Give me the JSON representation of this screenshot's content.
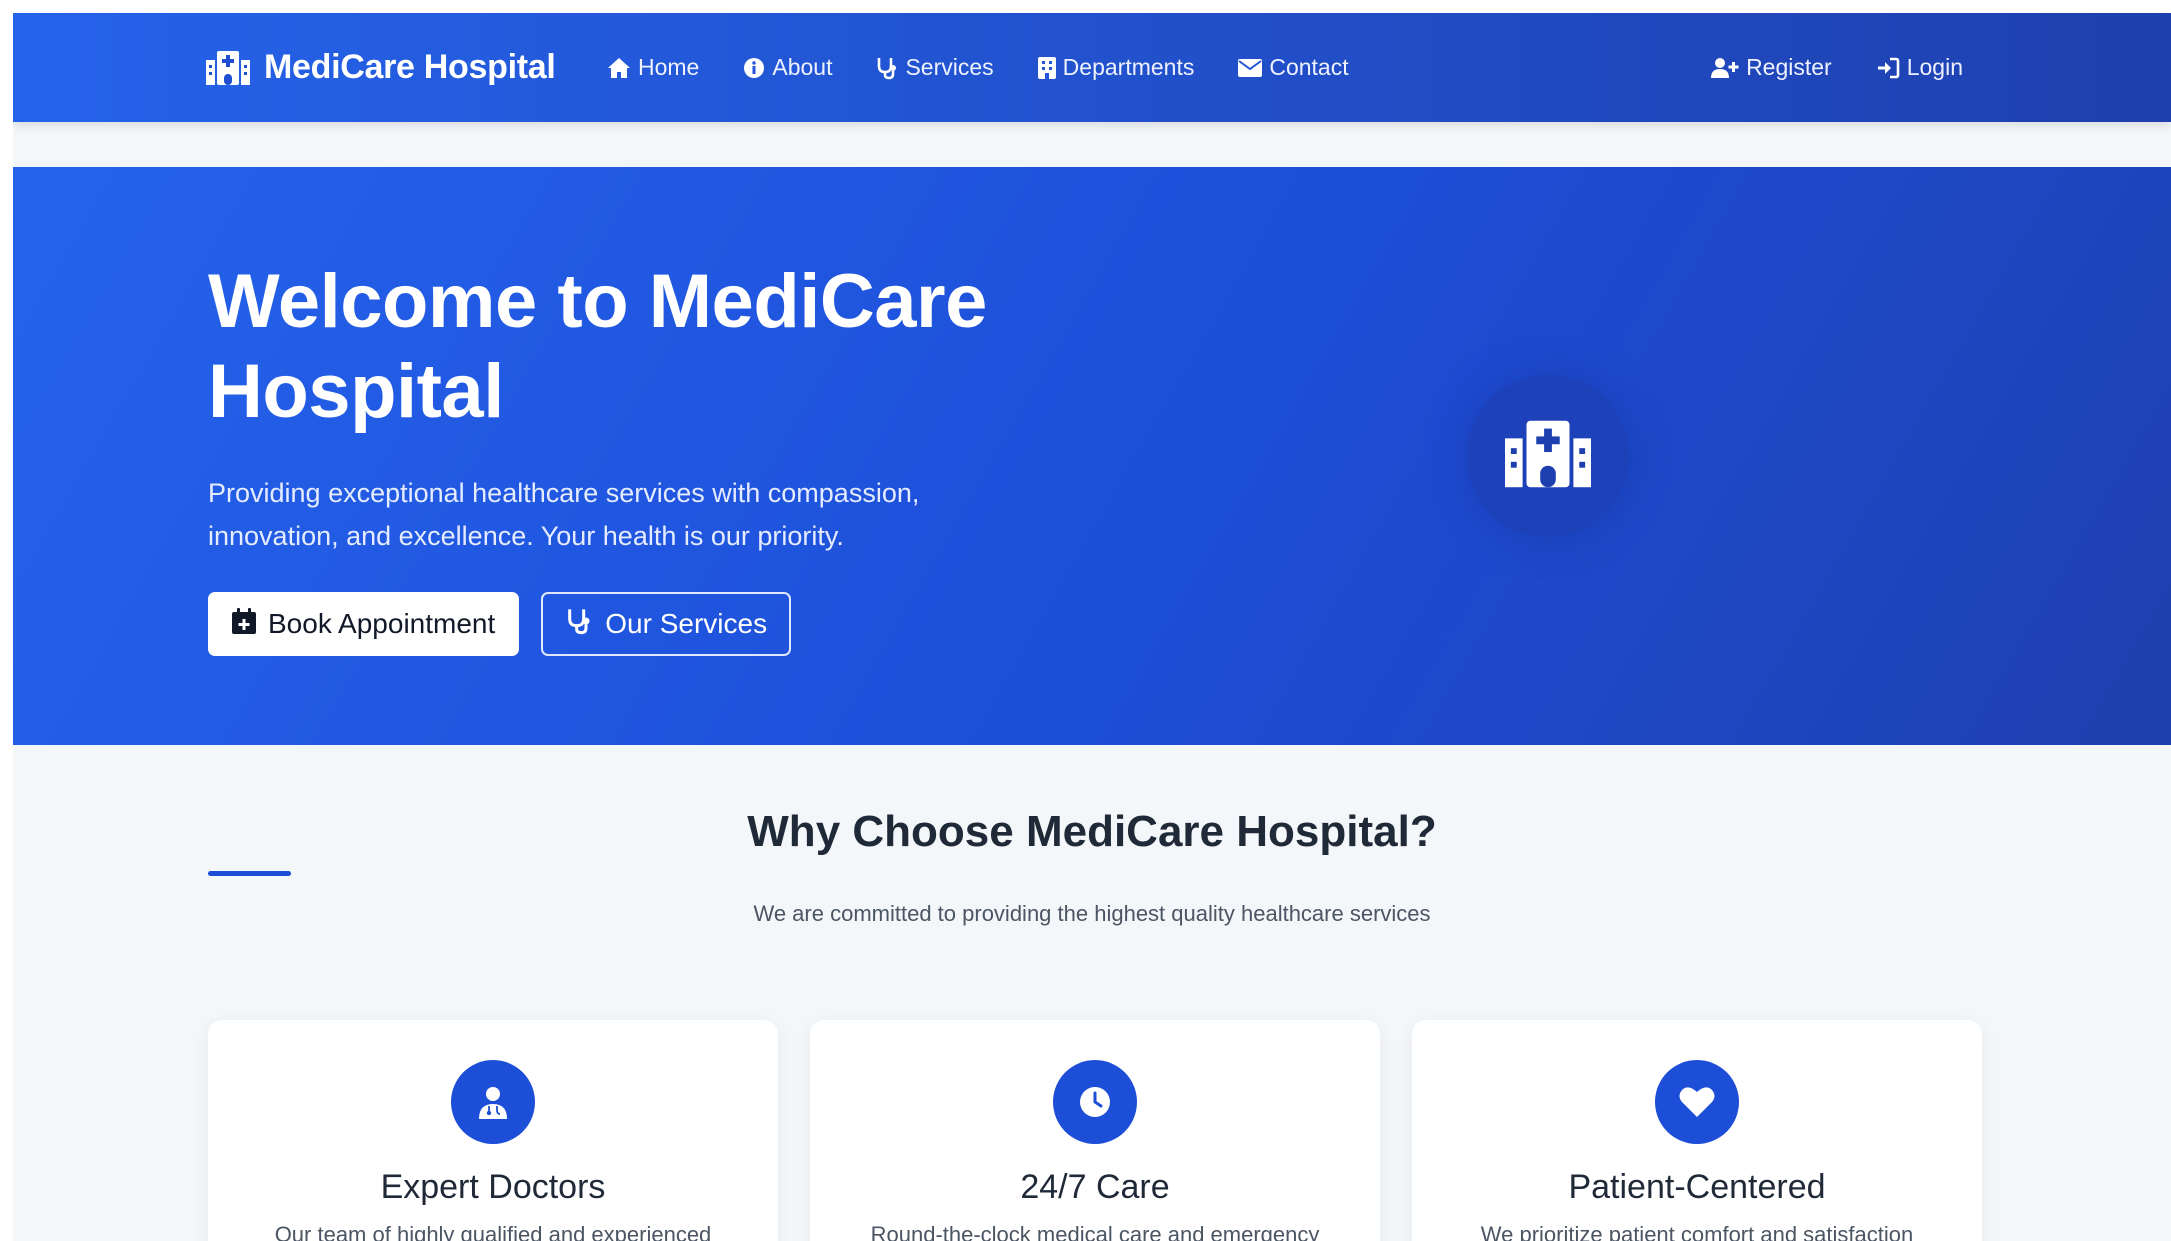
{
  "navbar": {
    "brand": "MediCare Hospital",
    "links": [
      {
        "label": "Home",
        "icon": "home-icon"
      },
      {
        "label": "About",
        "icon": "info-icon"
      },
      {
        "label": "Services",
        "icon": "stethoscope-icon"
      },
      {
        "label": "Departments",
        "icon": "building-icon"
      },
      {
        "label": "Contact",
        "icon": "envelope-icon"
      }
    ],
    "right_links": [
      {
        "label": "Register",
        "icon": "user-plus-icon"
      },
      {
        "label": "Login",
        "icon": "sign-in-icon"
      }
    ]
  },
  "hero": {
    "title_line1": "Welcome to MediCare",
    "title_line2": "Hospital",
    "subtitle_line1": "Providing exceptional healthcare services with compassion,",
    "subtitle_line2": "innovation, and excellence. Your health is our priority.",
    "primary_button": "Book Appointment",
    "secondary_button": "Our Services",
    "emblem_icon": "hospital-icon"
  },
  "why": {
    "title": "Why Choose MediCare Hospital?",
    "subtitle": "We are committed to providing the highest quality healthcare services",
    "cards": [
      {
        "title": "Expert Doctors",
        "text": "Our team of highly qualified and experienced",
        "icon": "user-doctor-icon"
      },
      {
        "title": "24/7 Care",
        "text": "Round-the-clock medical care and emergency",
        "icon": "clock-icon"
      },
      {
        "title": "Patient-Centered",
        "text": "We prioritize patient comfort and satisfaction",
        "icon": "heart-icon"
      }
    ]
  },
  "colors": {
    "primary": "#2563eb",
    "primary_dark": "#1e40af",
    "background": "#f4f7fa",
    "text_dark": "#1f2937"
  }
}
